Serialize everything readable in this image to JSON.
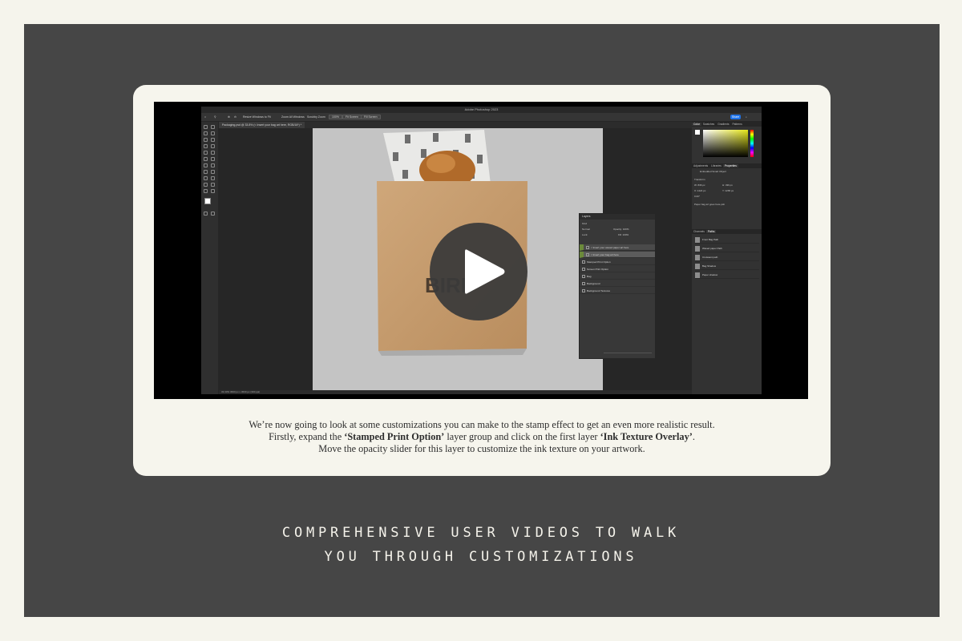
{
  "colors": {
    "background": "#f5f4ec",
    "panel": "#464646",
    "card": "#f6f5ed",
    "accent_green": "#6b8a3a",
    "tagline": "#f4f2ea",
    "share_blue": "#1f73e8"
  },
  "photoshop": {
    "window_title": "Adobe Photoshop 2023",
    "options_bar": {
      "resize_windows": "Resize Windows to Fit",
      "zoom_all": "Zoom All Windows",
      "scrubby_zoom": "Scrubby Zoom",
      "zoom_100": "100%",
      "fit_screen": "Fit Screen",
      "fill_screen": "Fill Screen",
      "share": "Share"
    },
    "document_tab": "Packaging.psd @ 33.8% (< Insert your bag art here, RGB/16*) *",
    "status_bar": "33.33%   3600 px x 3600 px (300 ppi)",
    "bag_print_text": "BIRD",
    "panels": {
      "color_tabs": [
        "Color",
        "Swatches",
        "Gradients",
        "Patterns"
      ],
      "properties_tabs": [
        "Adjustments",
        "Libraries",
        "Properties"
      ],
      "properties_title": "Embedded Smart Object",
      "transform_label": "Transform",
      "transform_values": {
        "w": "W: 836 px",
        "h": "H: 336 px",
        "x": "X: 1424 px",
        "y": "Y: 1265 px",
        "angle": "0.00°"
      },
      "smart_object_name": "Paper bag art goes here.psb",
      "paths_tabs": [
        "Channels",
        "Paths"
      ],
      "paths": [
        "Front Bag Path",
        "Waxed paper Path",
        "Croissant path",
        "Bag Shadow",
        "Paper shadow"
      ]
    },
    "layers_panel": {
      "title": "Layers",
      "filter_kind": "Kind",
      "blend_mode": "Normal",
      "opacity": "Opacity: 100%",
      "lock_label": "Lock:",
      "fill": "Fill: 100%",
      "rows": [
        "< Insert your waxed paper art here",
        "< Insert your bag art here",
        "Stamped Print Option",
        "Screen Print Option",
        "Bag",
        "Background",
        "Background Textures"
      ]
    }
  },
  "video": {
    "play_label": "Play video"
  },
  "caption": {
    "line1": "We’re now going to look at some customizations you can make to the stamp effect to get an even more realistic result.",
    "line2_pre": "Firstly, expand the ",
    "line2_bold1": "‘Stamped Print Option’",
    "line2_mid": " layer group and click on the first layer ",
    "line2_bold2": "‘Ink Texture Overlay’",
    "line2_post": ".",
    "line3": "Move the opacity slider for this layer to customize the ink texture on your artwork."
  },
  "tagline": {
    "line1": "COMPREHENSIVE USER VIDEOS TO WALK",
    "line2": "YOU THROUGH CUSTOMIZATIONS"
  }
}
